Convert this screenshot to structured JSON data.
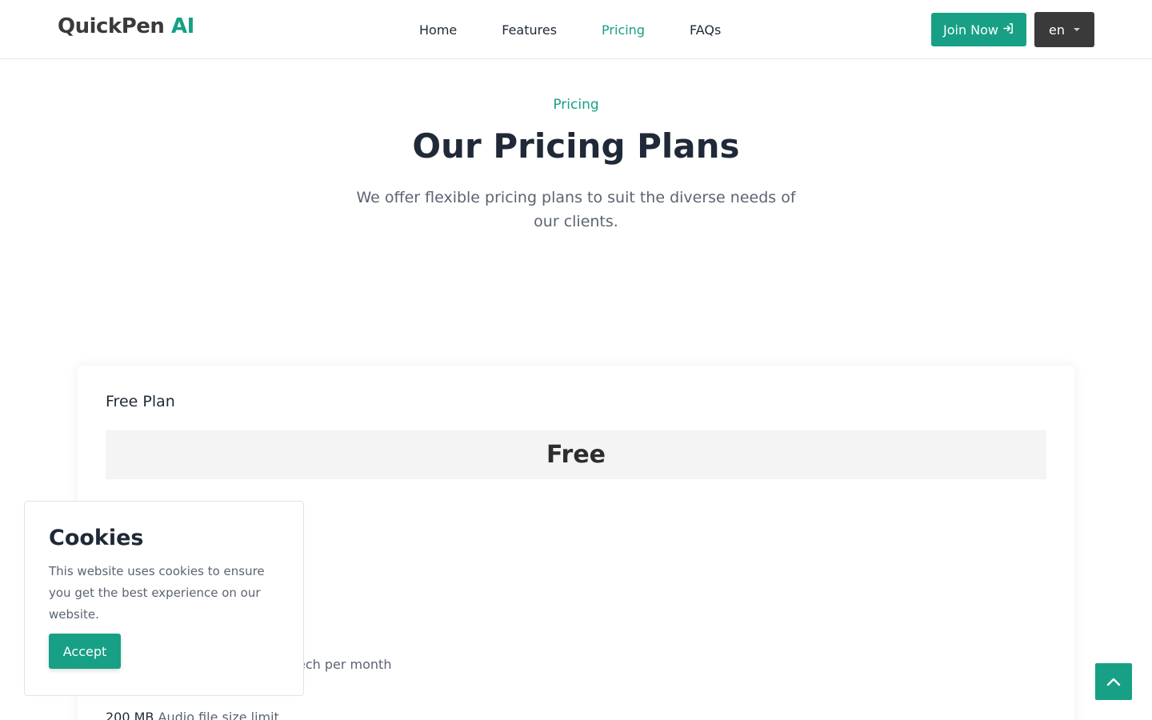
{
  "brand": {
    "name": "QuickPen",
    "suffix": "AI"
  },
  "nav": {
    "items": [
      {
        "label": "Home",
        "active": false
      },
      {
        "label": "Features",
        "active": false
      },
      {
        "label": "Pricing",
        "active": true
      },
      {
        "label": "FAQs",
        "active": false
      }
    ]
  },
  "header": {
    "join_label": "Join Now",
    "lang_label": "en"
  },
  "hero": {
    "eyebrow": "Pricing",
    "title": "Our Pricing Plans",
    "subtitle": "We offer flexible pricing plans to suit the diverse needs of our clients."
  },
  "plan": {
    "name": "Free Plan",
    "price": "Free",
    "features": [
      {
        "value": "",
        "label": "ech per month"
      },
      {
        "value": "200 MB",
        "label": "Audio file size limit"
      }
    ]
  },
  "cookie": {
    "title": "Cookies",
    "text": "This website uses cookies to ensure you get the best experience on our website.",
    "accept_label": "Accept"
  },
  "colors": {
    "accent": "#17a085",
    "dark": "#3a3a3a",
    "text": "#1f2937",
    "muted": "#5b6472"
  },
  "icons": {
    "join": "sign-in-icon",
    "lang": "caret-down-icon",
    "top": "chevron-up-icon"
  }
}
